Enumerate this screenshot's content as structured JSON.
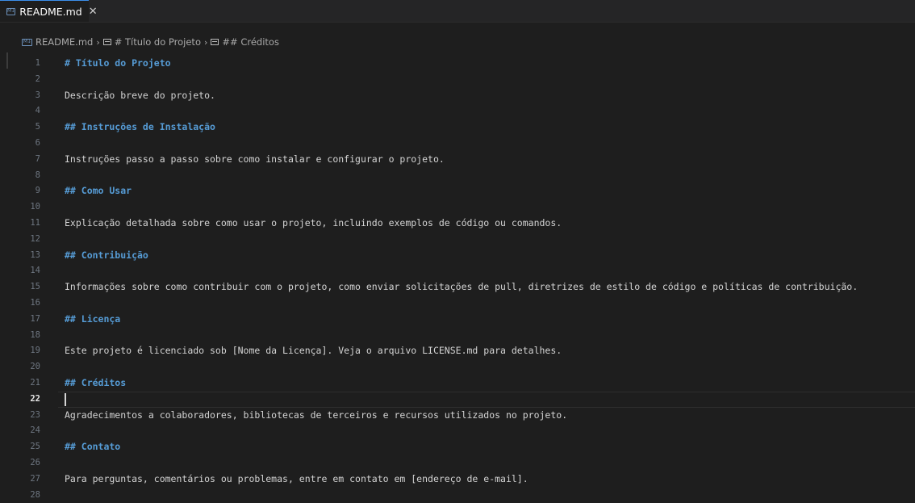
{
  "tab": {
    "label": "README.md",
    "close": "✕",
    "icon": "markdown-icon"
  },
  "breadcrumb": {
    "file": "README.md",
    "sep": "›",
    "items": [
      "# Título do Projeto",
      "## Créditos"
    ]
  },
  "editor": {
    "active_line": 22,
    "lines": [
      {
        "n": "1",
        "text": "# Título do Projeto",
        "heading": true
      },
      {
        "n": "2",
        "text": ""
      },
      {
        "n": "3",
        "text": "Descrição breve do projeto."
      },
      {
        "n": "4",
        "text": ""
      },
      {
        "n": "5",
        "text": "## Instruções de Instalação",
        "heading": true
      },
      {
        "n": "6",
        "text": ""
      },
      {
        "n": "7",
        "text": "Instruções passo a passo sobre como instalar e configurar o projeto."
      },
      {
        "n": "8",
        "text": ""
      },
      {
        "n": "9",
        "text": "## Como Usar",
        "heading": true
      },
      {
        "n": "10",
        "text": ""
      },
      {
        "n": "11",
        "text": "Explicação detalhada sobre como usar o projeto, incluindo exemplos de código ou comandos."
      },
      {
        "n": "12",
        "text": ""
      },
      {
        "n": "13",
        "text": "## Contribuição",
        "heading": true
      },
      {
        "n": "14",
        "text": ""
      },
      {
        "n": "15",
        "text": "Informações sobre como contribuir com o projeto, como enviar solicitações de pull, diretrizes de estilo de código e políticas de contribuição."
      },
      {
        "n": "16",
        "text": ""
      },
      {
        "n": "17",
        "text": "## Licença",
        "heading": true
      },
      {
        "n": "18",
        "text": ""
      },
      {
        "n": "19",
        "text": "Este projeto é licenciado sob [Nome da Licença]. Veja o arquivo LICENSE.md para detalhes."
      },
      {
        "n": "20",
        "text": ""
      },
      {
        "n": "21",
        "text": "## Créditos",
        "heading": true
      },
      {
        "n": "22",
        "text": ""
      },
      {
        "n": "23",
        "text": "Agradecimentos a colaboradores, bibliotecas de terceiros e recursos utilizados no projeto."
      },
      {
        "n": "24",
        "text": ""
      },
      {
        "n": "25",
        "text": "## Contato",
        "heading": true
      },
      {
        "n": "26",
        "text": ""
      },
      {
        "n": "27",
        "text": "Para perguntas, comentários ou problemas, entre em contato em [endereço de e-mail]."
      },
      {
        "n": "28",
        "text": ""
      }
    ]
  },
  "colors": {
    "heading": "#569cd6",
    "text": "#d4d4d4",
    "background": "#1e1e1e",
    "tab_accent": "#3b8eea"
  }
}
